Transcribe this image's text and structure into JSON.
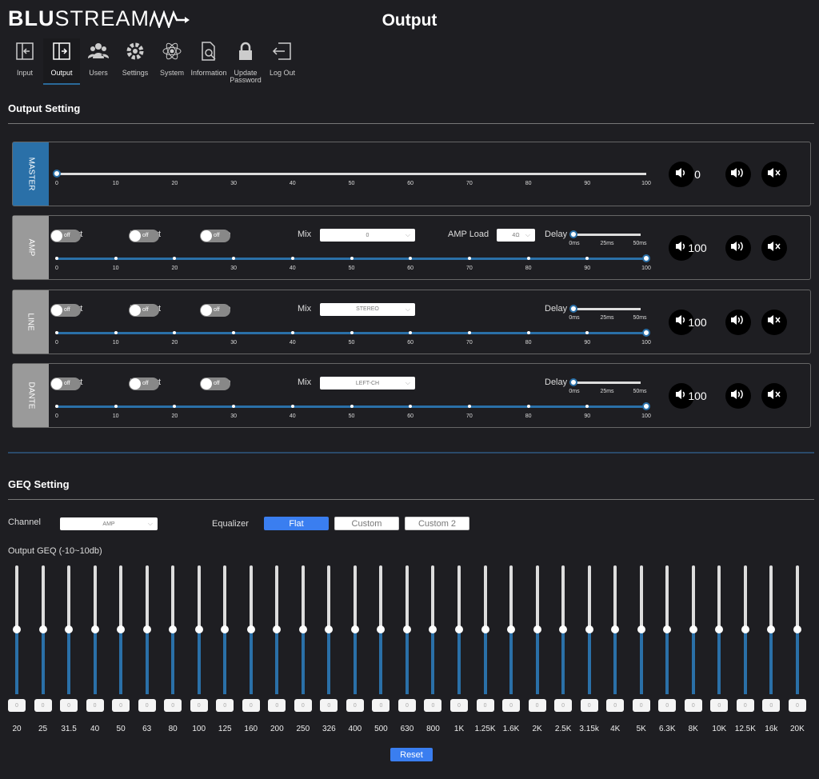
{
  "logo": {
    "text_bold": "BLU",
    "text_rest": "STREAM"
  },
  "page_title": "Output",
  "nav": [
    {
      "label": "Input",
      "icon": "input-icon"
    },
    {
      "label": "Output",
      "icon": "output-icon",
      "active": true
    },
    {
      "label": "Users",
      "icon": "users-icon"
    },
    {
      "label": "Settings",
      "icon": "gear-icon"
    },
    {
      "label": "System",
      "icon": "atom-icon"
    },
    {
      "label": "Information",
      "icon": "document-search-icon"
    },
    {
      "label": "Update Password",
      "icon": "lock-icon"
    },
    {
      "label": "Log Out",
      "icon": "logout-icon"
    }
  ],
  "output_setting": {
    "title": "Output Setting",
    "ticks": [
      "0",
      "10",
      "20",
      "30",
      "40",
      "50",
      "60",
      "70",
      "80",
      "90",
      "100"
    ],
    "delay_ticks": [
      "0ms",
      "25ms",
      "50ms"
    ],
    "labels": {
      "l_invert": "L-Invert",
      "r_invert": "R-Invert",
      "mute": "Mute",
      "mix": "Mix",
      "amp_load": "AMP Load",
      "delay": "Delay",
      "off": "off"
    },
    "master": {
      "label": "MASTER",
      "volume": 0
    },
    "channels": [
      {
        "label": "AMP",
        "mix": "0",
        "amp_load": "4Ω",
        "volume": 100,
        "delay": 0
      },
      {
        "label": "LINE",
        "mix": "STEREO",
        "volume": 100,
        "delay": 0
      },
      {
        "label": "DANTE",
        "mix": "LEFT-CH",
        "volume": 100,
        "delay": 0
      }
    ]
  },
  "geq": {
    "title": "GEQ Setting",
    "channel_label": "Channel",
    "channel_value": "AMP",
    "equalizer_label": "Equalizer",
    "presets": [
      {
        "label": "Flat",
        "active": true
      },
      {
        "label": "Custom"
      },
      {
        "label": "Custom 2"
      }
    ],
    "range_label": "Output GEQ (-10~10db)",
    "bands": [
      "20",
      "25",
      "31.5",
      "40",
      "50",
      "63",
      "80",
      "100",
      "125",
      "160",
      "200",
      "250",
      "326",
      "400",
      "500",
      "630",
      "800",
      "1K",
      "1.25K",
      "1.6K",
      "2K",
      "2.5K",
      "3.15k",
      "4K",
      "5K",
      "6.3K",
      "8K",
      "10K",
      "12.5K",
      "16k",
      "20K"
    ],
    "values": [
      0,
      0,
      0,
      0,
      0,
      0,
      0,
      0,
      0,
      0,
      0,
      0,
      0,
      0,
      0,
      0,
      0,
      0,
      0,
      0,
      0,
      0,
      0,
      0,
      0,
      0,
      0,
      0,
      0,
      0,
      0
    ],
    "reset_label": "Reset"
  },
  "colors": {
    "accent": "#2a70a8",
    "button_active": "#3a7ef0",
    "background": "#1e1e22"
  }
}
